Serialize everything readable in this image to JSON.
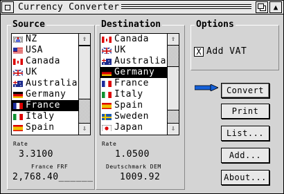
{
  "window": {
    "title": "Currency Converter"
  },
  "source": {
    "label": "Source",
    "items": [
      {
        "name": "NZ",
        "flag": "nz-flag"
      },
      {
        "name": "USA",
        "flag": "usa-flag"
      },
      {
        "name": "Canada",
        "flag": "canada-flag"
      },
      {
        "name": "UK",
        "flag": "uk-flag"
      },
      {
        "name": "Australia",
        "flag": "australia-flag"
      },
      {
        "name": "Germany",
        "flag": "germany-flag"
      },
      {
        "name": "France",
        "flag": "france-flag",
        "selected": true
      },
      {
        "name": "Italy",
        "flag": "italy-flag"
      },
      {
        "name": "Spain",
        "flag": "spain-flag"
      }
    ],
    "rate_label": "Rate",
    "rate_value": "3.3100",
    "currency_label": "France FRF",
    "amount_value": "2,768.40______"
  },
  "destination": {
    "label": "Destination",
    "items": [
      {
        "name": "Canada",
        "flag": "canada-flag"
      },
      {
        "name": "UK",
        "flag": "uk-flag"
      },
      {
        "name": "Australia",
        "flag": "australia-flag"
      },
      {
        "name": "Germany",
        "flag": "germany-flag",
        "selected": true
      },
      {
        "name": "France",
        "flag": "france-flag"
      },
      {
        "name": "Italy",
        "flag": "italy-flag"
      },
      {
        "name": "Spain",
        "flag": "spain-flag"
      },
      {
        "name": "Sweden",
        "flag": "sweden-flag"
      },
      {
        "name": "Japan",
        "flag": "japan-flag"
      }
    ],
    "rate_label": "Rate",
    "rate_value": "1.0500",
    "currency_label": "Deutschmark DEM",
    "amount_value": "1009.92"
  },
  "options": {
    "label": "Options",
    "add_vat_label": "Add VAT",
    "add_vat_checked": true,
    "check_mark": "X"
  },
  "buttons": {
    "convert": "Convert",
    "print": "Print",
    "list": "List...",
    "add": "Add...",
    "about": "About..."
  },
  "colors": {
    "selection": "#000000",
    "arrow": "#1560d8"
  }
}
